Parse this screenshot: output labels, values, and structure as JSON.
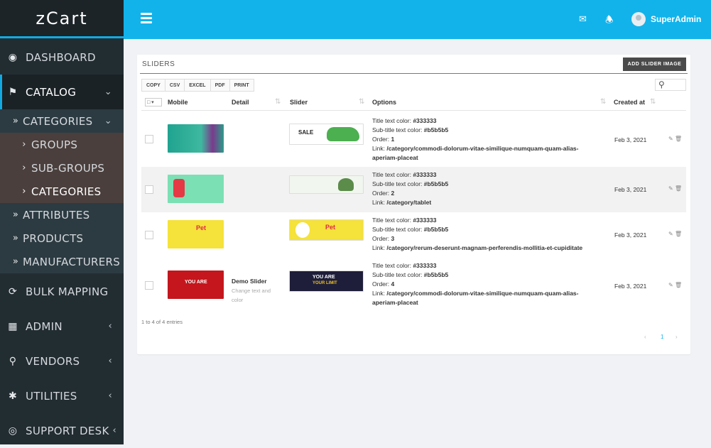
{
  "brand": "zCart",
  "sidebar": {
    "dashboard": "DASHBOARD",
    "catalog": "CATALOG",
    "categories": "CATEGORIES",
    "groups": "GROUPS",
    "sub_groups": "SUB-GROUPS",
    "categories_child": "CATEGORIES",
    "attributes": "ATTRIBUTES",
    "products": "PRODUCTS",
    "manufacturers": "MANUFACTURERS",
    "bulk_mapping": "BULK MAPPING",
    "admin": "ADMIN",
    "vendors": "VENDORS",
    "utilities": "UTILITIES",
    "support_desk": "SUPPORT DESK"
  },
  "header": {
    "username": "SuperAdmin"
  },
  "card": {
    "title": "SLIDERS",
    "add_button": "ADD SLIDER IMAGE",
    "export": [
      "COPY",
      "CSV",
      "EXCEL",
      "PDF",
      "PRINT"
    ],
    "columns": {
      "mobile": "Mobile",
      "detail": "Detail",
      "slider": "Slider",
      "options": "Options",
      "created": "Created at"
    },
    "rows": [
      {
        "detail_title": "",
        "detail_sub": "",
        "title_color_label": "Title text color: ",
        "title_color": "#333333",
        "sub_color_label": "Sub-title text color: ",
        "sub_color": "#b5b5b5",
        "order_label": "Order: ",
        "order": "1",
        "link_label": "Link: ",
        "link": "/category/commodi-dolorum-vitae-similique-numquam-quam-alias-aperiam-placeat",
        "created": "Feb 3, 2021"
      },
      {
        "detail_title": "",
        "detail_sub": "",
        "title_color_label": "Title text color: ",
        "title_color": "#333333",
        "sub_color_label": "Sub-title text color: ",
        "sub_color": "#b5b5b5",
        "order_label": "Order: ",
        "order": "2",
        "link_label": "Link: ",
        "link": "/category/tablet",
        "created": "Feb 3, 2021"
      },
      {
        "detail_title": "Demo Slider",
        "detail_sub": "Change text and color",
        "title_color_label": "Title text color: ",
        "title_color": "#333333",
        "sub_color_label": "Sub-title text color: ",
        "sub_color": "#b5b5b5",
        "order_label": "Order: ",
        "order": "3",
        "link_label": "Link: ",
        "link": "/category/rerum-deserunt-magnam-perferendis-mollitia-et-cupiditate",
        "created": "Feb 3, 2021"
      },
      {
        "detail_title": "",
        "detail_sub": "",
        "title_color_label": "Title text color: ",
        "title_color": "#333333",
        "sub_color_label": "Sub-title text color: ",
        "sub_color": "#b5b5b5",
        "order_label": "Order: ",
        "order": "4",
        "link_label": "Link: ",
        "link": "/category/commodi-dolorum-vitae-similique-numquam-quam-alias-aperiam-placeat",
        "created": "Feb 3, 2021"
      }
    ],
    "info": "1 to 4 of 4 entries",
    "page": "1",
    "slider_texts": {
      "sale": "SALE",
      "pet": "Pet",
      "you_are": "YOU ARE",
      "your_limit": "YOUR LIMIT"
    }
  },
  "colors": {
    "accent": "#12b3eb",
    "sidebar": "#222d32"
  }
}
